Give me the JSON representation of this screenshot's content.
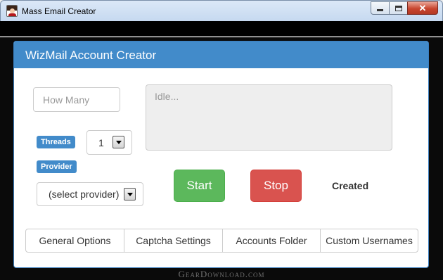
{
  "window": {
    "title": "Mass Email Creator",
    "close_glyph": "✕"
  },
  "panel": {
    "heading": "WizMail Account Creator"
  },
  "form": {
    "how_many_placeholder": "How Many",
    "status_placeholder": "Idle...",
    "threads_label": "Threads",
    "threads_value": "1",
    "provider_label": "Provider",
    "provider_value": "(select provider)"
  },
  "actions": {
    "start_label": "Start",
    "stop_label": "Stop",
    "created_label": "Created"
  },
  "tabs": [
    {
      "label": "General Options"
    },
    {
      "label": "Captcha Settings"
    },
    {
      "label": "Accounts Folder"
    },
    {
      "label": "Custom Usernames"
    }
  ],
  "watermark": "GearDownload.com",
  "colors": {
    "primary": "#428bca",
    "success": "#5cb85c",
    "danger": "#d9534f"
  }
}
